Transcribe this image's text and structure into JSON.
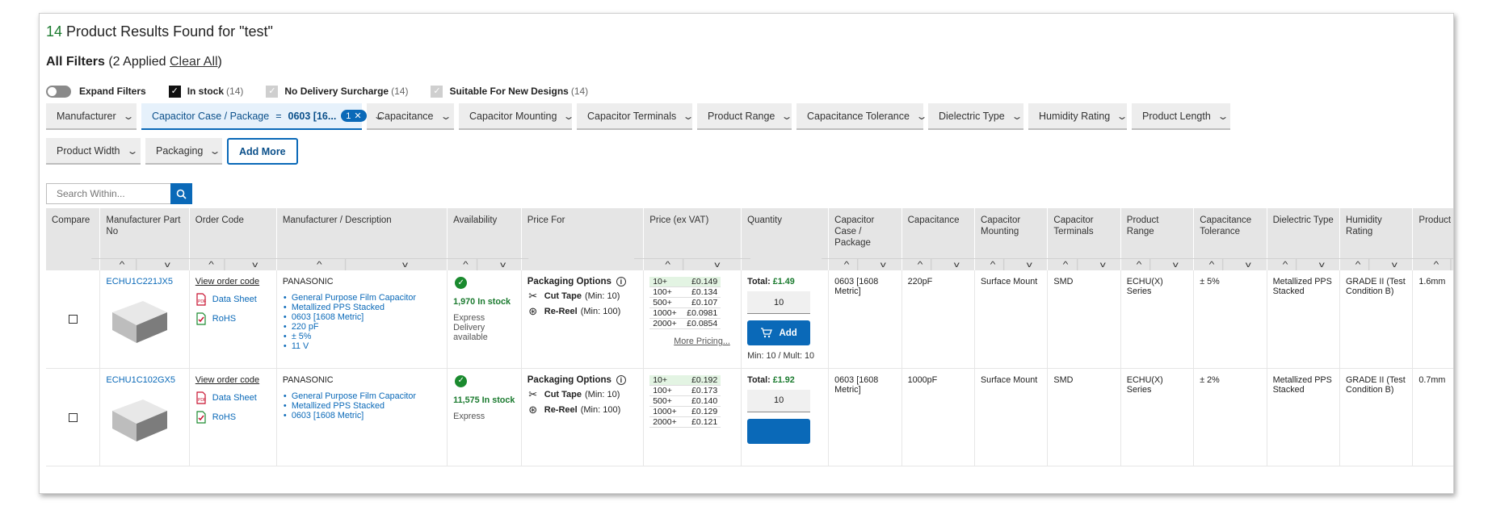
{
  "results": {
    "count": "14",
    "text": " Product Results Found for \"test\""
  },
  "filters": {
    "title": "All Filters",
    "applied": " (2 Applied ",
    "clear": "Clear All",
    "close": ")"
  },
  "toggles": {
    "expand": "Expand Filters",
    "in_stock": {
      "label": "In stock",
      "count": "(14)"
    },
    "no_surcharge": {
      "label": "No Delivery Surcharge",
      "count": "(14)"
    },
    "new_designs": {
      "label": "Suitable For New Designs",
      "count": "(14)"
    }
  },
  "filter_buttons": {
    "manufacturer": "Manufacturer",
    "case_package": {
      "label": "Capacitor Case / Package",
      "eq": "=",
      "value": "0603 [16...",
      "pill": "1"
    },
    "capacitance": "Capacitance",
    "mounting": "Capacitor Mounting",
    "terminals": "Capacitor Terminals",
    "product_range": "Product Range",
    "tolerance": "Capacitance Tolerance",
    "dielectric": "Dielectric Type",
    "humidity": "Humidity Rating",
    "length": "Product Length",
    "width": "Product Width",
    "packaging": "Packaging",
    "add_more": "Add More"
  },
  "search": {
    "placeholder": "Search Within..."
  },
  "columns": {
    "compare": "Compare",
    "mpn": "Manufacturer Part No",
    "order_code": "Order Code",
    "mfr_desc": "Manufacturer / Description",
    "availability": "Availability",
    "price_for": "Price For",
    "price": "Price (ex VAT)",
    "quantity": "Quantity",
    "case_package": "Capacitor Case / Package",
    "capacitance": "Capacitance",
    "mounting": "Capacitor Mounting",
    "terminals": "Capacitor Terminals",
    "product_range": "Product Range",
    "tolerance": "Capacitance Tolerance",
    "dielectric": "Dielectric Type",
    "humidity": "Humidity Rating",
    "length": "Product Length"
  },
  "rows": [
    {
      "mpn": "ECHU1C221JX5",
      "order_code": "View order code",
      "datasheet": "Data Sheet",
      "rohs": "RoHS",
      "manufacturer": "PANASONIC",
      "desc": [
        "General Purpose Film Capacitor",
        "Metallized PPS Stacked",
        "0603 [1608 Metric]",
        "220 pF",
        "± 5%",
        "11 V"
      ],
      "stock": "1,970 In stock",
      "express": "Express Delivery available",
      "pack_title": "Packaging Options",
      "cut_tape": "Cut Tape",
      "cut_tape_min": "(Min: 10)",
      "re_reel": "Re-Reel",
      "re_reel_min": "(Min: 100)",
      "prices": [
        [
          "10+",
          "£0.149"
        ],
        [
          "100+",
          "£0.134"
        ],
        [
          "500+",
          "£0.107"
        ],
        [
          "1000+",
          "£0.0981"
        ],
        [
          "2000+",
          "£0.0854"
        ]
      ],
      "more_pricing": "More Pricing...",
      "total_label": "Total: ",
      "total": "£1.49",
      "qty": "10",
      "add": "Add",
      "min_mult": "Min: 10 / Mult: 10",
      "case_package": "0603 [1608 Metric]",
      "capacitance": "220pF",
      "mounting": "Surface Mount",
      "terminals": "SMD",
      "product_range": "ECHU(X) Series",
      "tolerance": "± 5%",
      "dielectric": "Metallized PPS Stacked",
      "humidity": "GRADE II (Test Condition B)",
      "length": "1.6mm"
    },
    {
      "mpn": "ECHU1C102GX5",
      "order_code": "View order code",
      "datasheet": "Data Sheet",
      "rohs": "RoHS",
      "manufacturer": "PANASONIC",
      "desc": [
        "General Purpose Film Capacitor",
        "Metallized PPS Stacked",
        "0603 [1608 Metric]"
      ],
      "stock": "11,575 In stock",
      "express": "Express",
      "pack_title": "Packaging Options",
      "cut_tape": "Cut Tape",
      "cut_tape_min": "(Min: 10)",
      "re_reel": "Re-Reel",
      "re_reel_min": "(Min: 100)",
      "prices": [
        [
          "10+",
          "£0.192"
        ],
        [
          "100+",
          "£0.173"
        ],
        [
          "500+",
          "£0.140"
        ],
        [
          "1000+",
          "£0.129"
        ],
        [
          "2000+",
          "£0.121"
        ]
      ],
      "total_label": "Total: ",
      "total": "£1.92",
      "qty": "10",
      "case_package": "0603 [1608 Metric]",
      "capacitance": "1000pF",
      "mounting": "Surface Mount",
      "terminals": "SMD",
      "product_range": "ECHU(X) Series",
      "tolerance": "± 2%",
      "dielectric": "Metallized PPS Stacked",
      "humidity": "GRADE II (Test Condition B)",
      "length": "0.7mm"
    }
  ],
  "colors": {
    "accent": "#0a69b8",
    "stock_green": "#1a7a2e",
    "header_gray": "#e5e5e5"
  }
}
